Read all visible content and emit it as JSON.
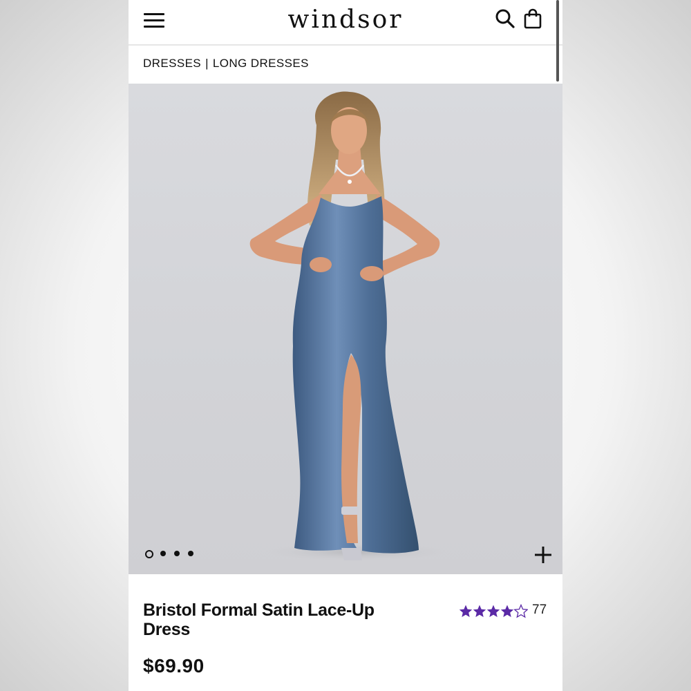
{
  "header": {
    "logo_text": "windsor",
    "menu_icon": "hamburger-menu-icon",
    "search_icon": "search-icon",
    "bag_icon": "shopping-bag-icon"
  },
  "breadcrumb": {
    "items": [
      "DRESSES",
      "LONG DRESSES"
    ],
    "separator": "|"
  },
  "gallery": {
    "image_count": 4,
    "active_index": 0,
    "zoom_icon": "plus-icon"
  },
  "product": {
    "title": "Bristol Formal Satin Lace-Up Dress",
    "price": "$69.90",
    "rating": 4.5,
    "rating_max": 5,
    "review_count": "77"
  },
  "colors": {
    "accent_star": "#5b2aa6",
    "dress": "#4f6f97",
    "text": "#111111"
  }
}
